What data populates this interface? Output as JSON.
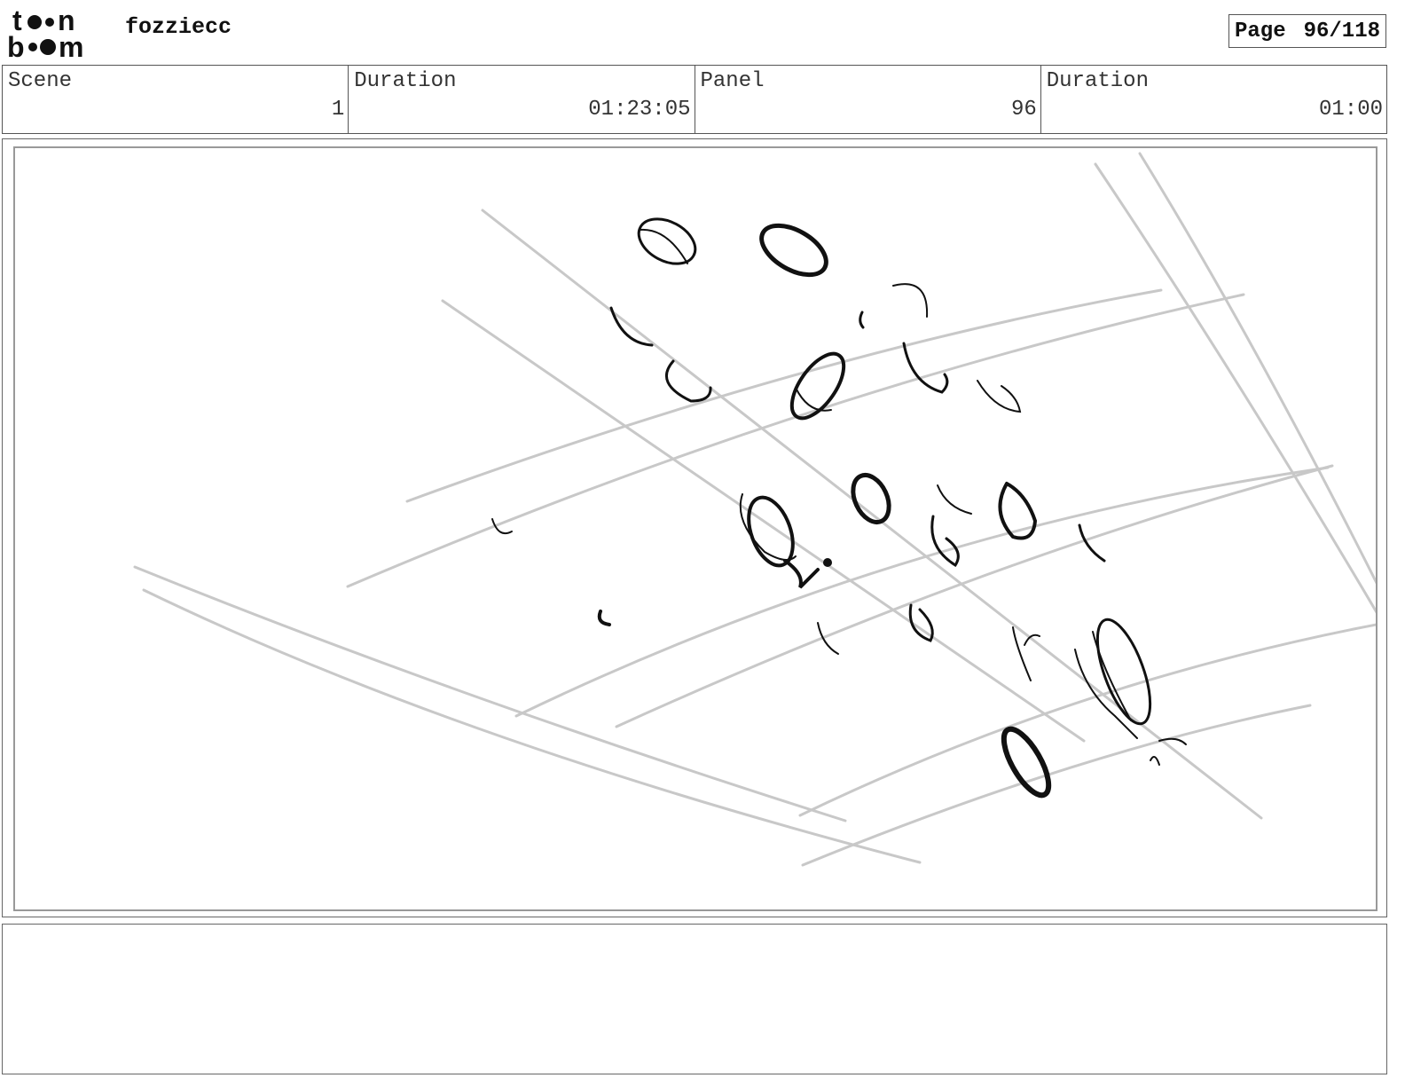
{
  "header": {
    "logo_text": "toon boom",
    "project_name": "fozziecc",
    "page_label": "Page",
    "page_value": "96/118"
  },
  "info": {
    "scene_label": "Scene",
    "scene_value": "1",
    "scene_duration_label": "Duration",
    "scene_duration_value": "01:23:05",
    "panel_label": "Panel",
    "panel_value": "96",
    "panel_duration_label": "Duration",
    "panel_duration_value": "01:00"
  },
  "colors": {
    "guide_lines": "#c8c8c8",
    "ink": "#111111"
  },
  "notes": {
    "text": ""
  }
}
